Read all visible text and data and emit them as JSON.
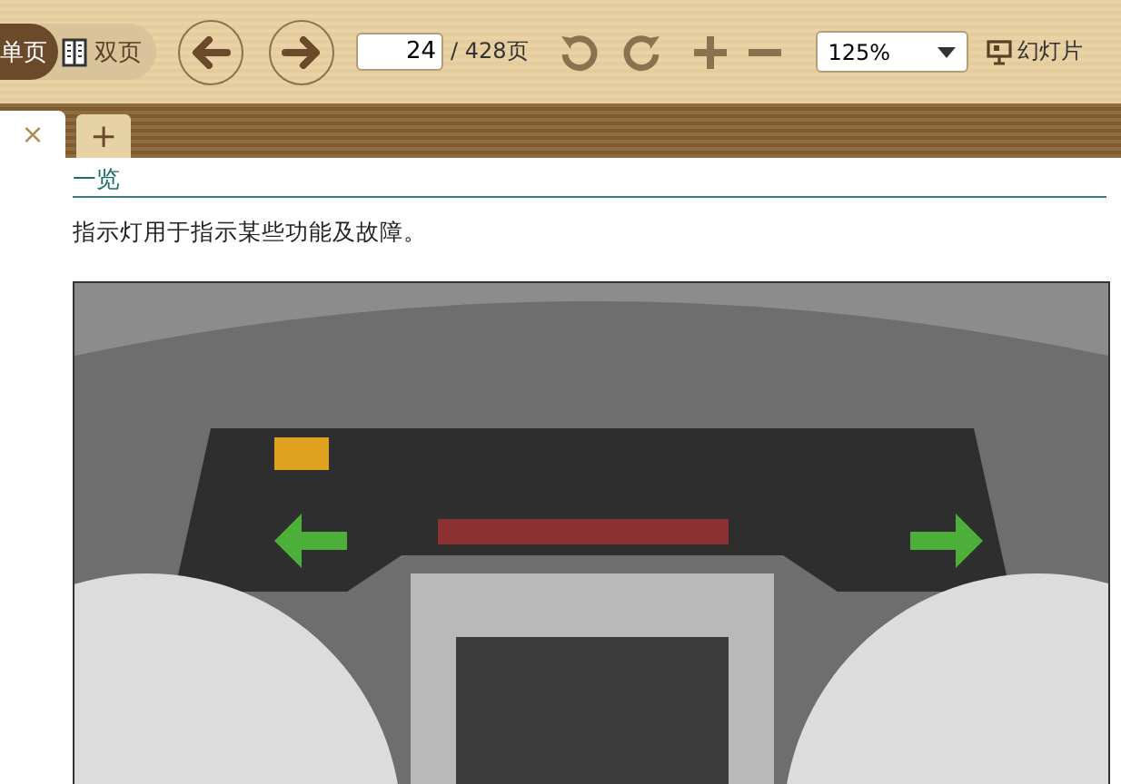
{
  "toolbar": {
    "view_modes": [
      {
        "label": "单页",
        "selected": true
      },
      {
        "label": "双页",
        "selected": false
      }
    ],
    "page_input": {
      "value": "24"
    },
    "page_total": "/ 428页",
    "zoom_select": {
      "value": "125%"
    },
    "slideshow": "幻灯片"
  },
  "tabs": [
    {
      "close": "×",
      "selected": true
    }
  ],
  "new_tab": "+",
  "document": {
    "heading": "一览",
    "paragraph": "指示灯用于指示某些功能及故障。"
  }
}
